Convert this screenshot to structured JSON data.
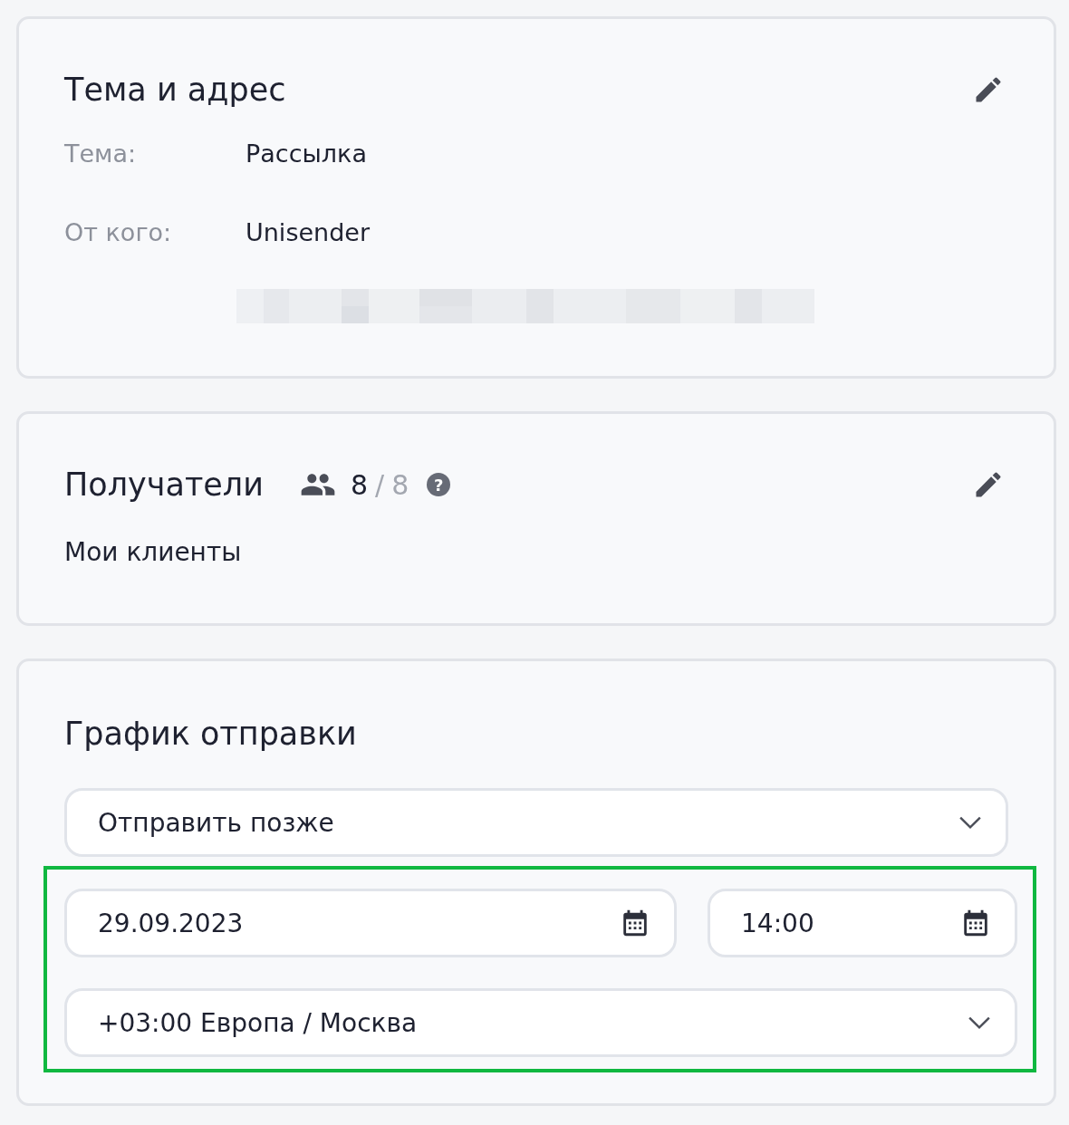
{
  "subject_card": {
    "title": "Тема и адрес",
    "editable": true,
    "rows": [
      {
        "label": "Тема:",
        "value": "Рассылка"
      },
      {
        "label": "От кого:",
        "value": "Unisender"
      }
    ],
    "address_hidden": true
  },
  "recipients_card": {
    "title": "Получатели",
    "editable": true,
    "count": "8",
    "separator": "/",
    "total": "8",
    "help": "?",
    "list": "Мои клиенты"
  },
  "schedule_card": {
    "title": "График отправки",
    "mode": {
      "value": "Отправить позже"
    },
    "date": {
      "value": "29.09.2023"
    },
    "time": {
      "value": "14:00"
    },
    "timezone": {
      "value": "+03:00 Европа / Москва"
    },
    "highlighted": true
  }
}
